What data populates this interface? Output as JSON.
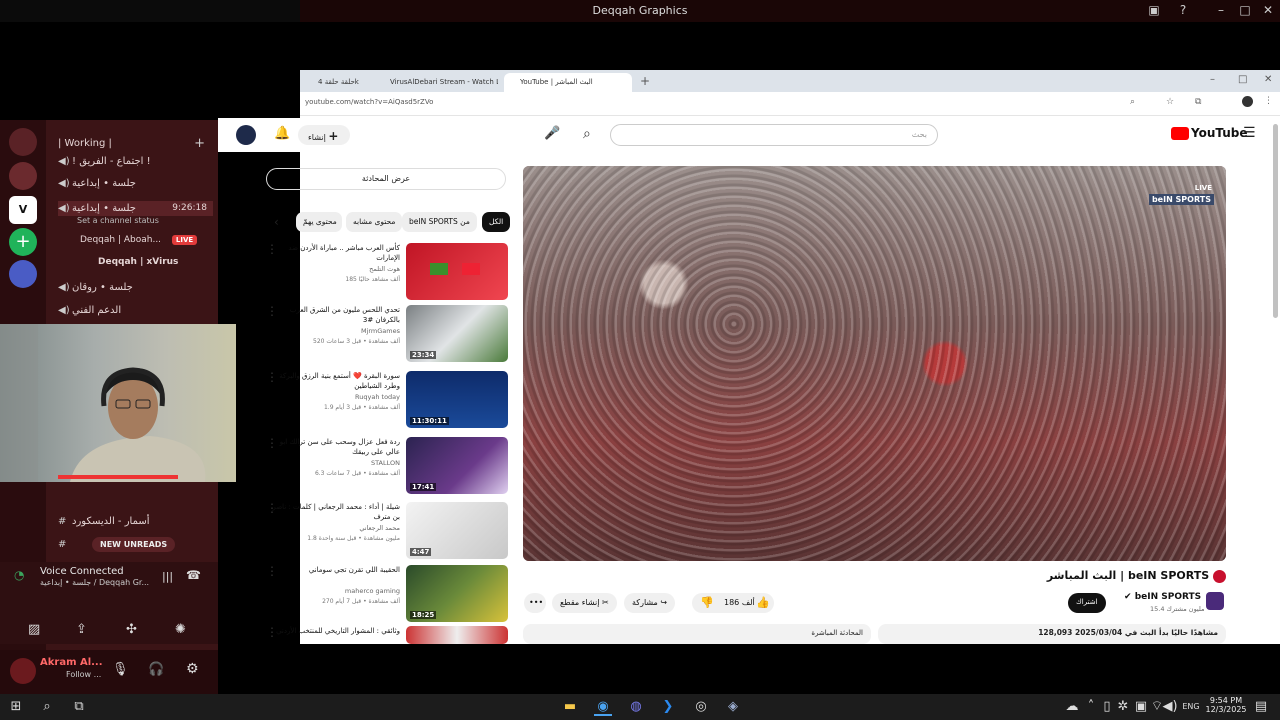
{
  "window": {
    "title": "Deqqah Graphics"
  },
  "discord": {
    "category": "| Working |",
    "channels": [
      "! اجتماع - الفريق !",
      "جلسة • إبداعية",
      "جلسة • إبداعية",
      "جلسة • روقان",
      "الدعم الفني"
    ],
    "status_time": "9:26:18",
    "status_hint": "Set a channel status",
    "member1": "Deqqah | Aboah...",
    "live_badge": "LIVE",
    "member2": "Deqqah | xVirus",
    "text_channel": "أسمار - الديسكورد",
    "new_unreads": "NEW UNREADS",
    "voice_title": "Voice Connected",
    "voice_sub": "جلسة • إبداعية / Deqqah Gr...",
    "user_name": "Akram Al...",
    "user_status": "Follow ..."
  },
  "browser": {
    "tabs": [
      "حلقة حلقة 4k",
      "VirusAlDebari Stream - Watch L...",
      "YouTube | البث المباشر"
    ],
    "url": "youtube.com/watch?v=AiQasd5rZVo"
  },
  "youtube": {
    "logo": "YouTube",
    "search_placeholder": "بحث",
    "create": "إنشاء",
    "chat_toggle": "عرض المحادثة",
    "chips": [
      "الكل",
      "beIN SPORTS من",
      "محتوى مشابه",
      "محتوى يهمّ"
    ],
    "live_label": "LIVE",
    "brand": "beIN SPORTS",
    "video_title": "البث المباشر | beIN SPORTS",
    "channel": "beIN SPORTS",
    "subs": "15.4 مليون مشترك",
    "subscribe": "اشتراك",
    "likes": "186 ألف",
    "share": "مشاركة",
    "clip": "إنشاء مقطع",
    "views": "128,093 مشاهدًا حاليًا  بدأ البث في 2025/03/04",
    "live_chat": "المحادثة المباشرة",
    "sidebar": [
      {
        "title": "كأس العرب مباشر .. مباراة الأردن ضد الإمارات",
        "channel": "هوت التلمح",
        "meta": "185 ألف مشاهد حاليًا",
        "dur": ""
      },
      {
        "title": "تحدي اللحس مليون من الشرق العرب بالكرفان #3",
        "channel": "MjrmGames",
        "meta": "520 ألف مشاهدة • قبل 3 ساعات",
        "dur": "23:34"
      },
      {
        "title": "سورة البقرة ❤️ أستمع بنية الرزق والبركة وطرد الشياطين",
        "channel": "Ruqyah today",
        "meta": "1.9 ألف مشاهدة • قبل 3 أيام",
        "dur": "11:30:11"
      },
      {
        "title": "ردة فعل عزال وسحب على سن ترالك ابو عالي على ربيقك",
        "channel": "STALLON",
        "meta": "6.3 ألف مشاهدة • قبل 7 ساعات",
        "dur": "17:41"
      },
      {
        "title": "شيلة | أداء : محمد الرجعاني | كلمات : ناصر بن مترف",
        "channel": "محمد الرجعاني",
        "meta": "1.8 مليون مشاهدة • قبل سنة واحدة",
        "dur": "4:47"
      },
      {
        "title": "الحقيبة اللي تقرن تجي سوماني",
        "channel": "maherco gaming",
        "meta": "270 ألف مشاهدة • قبل 7 أيام",
        "dur": "18:25"
      },
      {
        "title": "وثائقي : المشوار التاريخي للمنتخب الأردني",
        "channel": "",
        "meta": "",
        "dur": ""
      }
    ]
  },
  "taskbar": {
    "lang": "ENG",
    "time": "9:54 PM",
    "date": "12/3/2025"
  }
}
